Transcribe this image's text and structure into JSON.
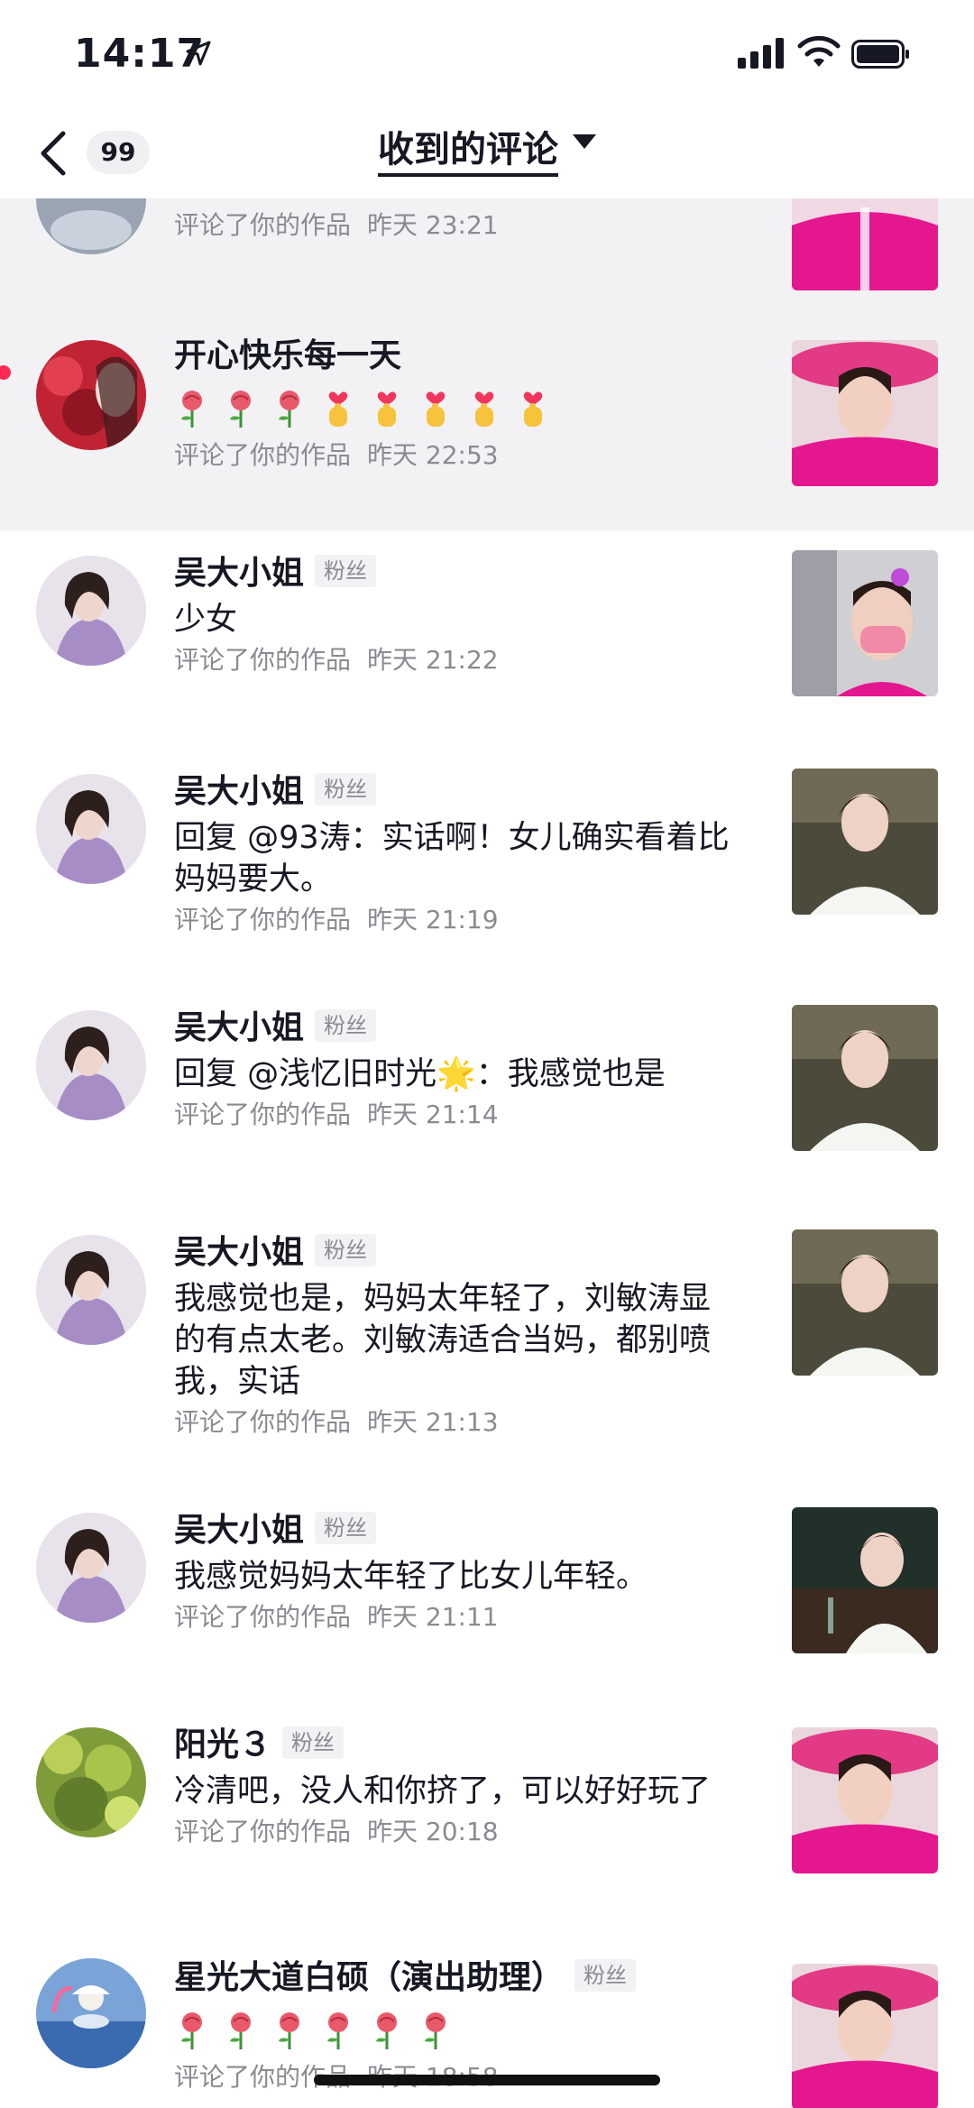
{
  "status_bar": {
    "time": "14:17"
  },
  "nav": {
    "badge_count": "99",
    "title": "收到的评论"
  },
  "items": [
    {
      "name": "",
      "text": "",
      "action": "评论了你的作品",
      "time": "昨天 23:21"
    },
    {
      "name": "开心快乐每一天",
      "emojis": [
        "rose",
        "rose",
        "rose",
        "finger-heart",
        "finger-heart",
        "finger-heart",
        "finger-heart",
        "finger-heart"
      ],
      "action": "评论了你的作品",
      "time": "昨天 22:53"
    },
    {
      "name": "吴大小姐",
      "tag": "粉丝",
      "text": "少女",
      "action": "评论了你的作品",
      "time": "昨天 21:22"
    },
    {
      "name": "吴大小姐",
      "tag": "粉丝",
      "text": "回复 @93涛：实话啊！女儿确实看着比妈妈要大。",
      "action": "评论了你的作品",
      "time": "昨天 21:19"
    },
    {
      "name": "吴大小姐",
      "tag": "粉丝",
      "text": "回复 @浅忆旧时光🌟：我感觉也是",
      "action": "评论了你的作品",
      "time": "昨天 21:14"
    },
    {
      "name": "吴大小姐",
      "tag": "粉丝",
      "text": "我感觉也是，妈妈太年轻了，刘敏涛显的有点太老。刘敏涛适合当妈，都别喷我，实话",
      "action": "评论了你的作品",
      "time": "昨天 21:13"
    },
    {
      "name": "吴大小姐",
      "tag": "粉丝",
      "text": "我感觉妈妈太年轻了比女儿年轻。",
      "action": "评论了你的作品",
      "time": "昨天 21:11"
    },
    {
      "name": "阳光３",
      "tag": "粉丝",
      "text": "冷清吧，没人和你挤了，可以好好玩了",
      "action": "评论了你的作品",
      "time": "昨天 20:18"
    },
    {
      "name": "星光大道白硕（演出助理）",
      "tag": "粉丝",
      "emojis": [
        "rose",
        "rose",
        "rose",
        "rose",
        "rose",
        "rose"
      ],
      "action": "评论了你的作品",
      "time": "昨天 18:58"
    }
  ],
  "colors": {
    "accent": "#fe2c55",
    "secondary_text": "#8a8b91",
    "unread_bg": "#f2f2f4"
  }
}
